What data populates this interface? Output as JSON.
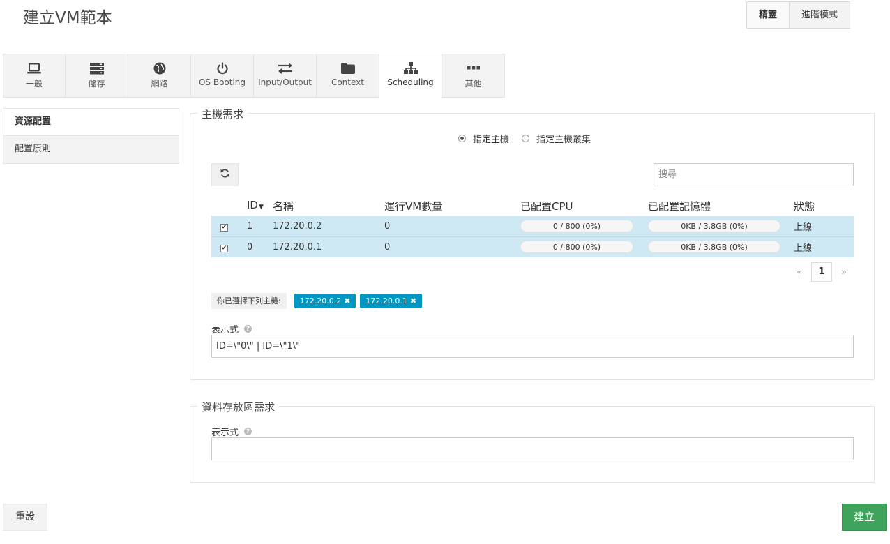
{
  "page": {
    "title": "建立VM範本"
  },
  "mode": {
    "wizard_label": "精靈",
    "advanced_label": "進階模式"
  },
  "tabs": [
    {
      "label": "一般",
      "icon": "laptop-icon"
    },
    {
      "label": "儲存",
      "icon": "storage-icon"
    },
    {
      "label": "網路",
      "icon": "globe-icon"
    },
    {
      "label": "OS Booting",
      "icon": "power-icon"
    },
    {
      "label": "Input/Output",
      "icon": "exchange-icon"
    },
    {
      "label": "Context",
      "icon": "folder-icon"
    },
    {
      "label": "Scheduling",
      "icon": "sitemap-icon",
      "active": true
    },
    {
      "label": "其他",
      "icon": "ellipsis-icon"
    }
  ],
  "sidebar": {
    "items": [
      {
        "label": "資源配置",
        "active": true
      },
      {
        "label": "配置原則"
      }
    ]
  },
  "host_requirements": {
    "legend": "主機需求",
    "radio_host": "指定主機",
    "radio_cluster": "指定主機叢集",
    "selected_radio": "host",
    "search_placeholder": "搜尋",
    "columns": {
      "id": "ID",
      "name": "名稱",
      "running_vms": "運行VM數量",
      "allocated_cpu": "已配置CPU",
      "allocated_memory": "已配置記憶體",
      "status": "狀態"
    },
    "rows": [
      {
        "checked": true,
        "id": "1",
        "name": "172.20.0.2",
        "running_vms": "0",
        "cpu": "0 / 800 (0%)",
        "memory": "0KB / 3.8GB (0%)",
        "status": "上線"
      },
      {
        "checked": true,
        "id": "0",
        "name": "172.20.0.1",
        "running_vms": "0",
        "cpu": "0 / 800 (0%)",
        "memory": "0KB / 3.8GB (0%)",
        "status": "上線"
      }
    ],
    "pager": {
      "prev": "«",
      "page": "1",
      "next": "»"
    },
    "selected_label": "你已選擇下列主機:",
    "selected_hosts": [
      "172.20.0.2",
      "172.20.0.1"
    ],
    "expression_label": "表示式",
    "expression_value": "ID=\\\"0\\\" | ID=\\\"1\\\""
  },
  "datastore_requirements": {
    "legend": "資料存放區需求",
    "expression_label": "表示式",
    "expression_value": ""
  },
  "footer": {
    "reset_label": "重設",
    "create_label": "建立"
  },
  "colors": {
    "accent": "#0098c3",
    "create_button": "#3fa35b",
    "selected_row": "#cfe9f4"
  }
}
